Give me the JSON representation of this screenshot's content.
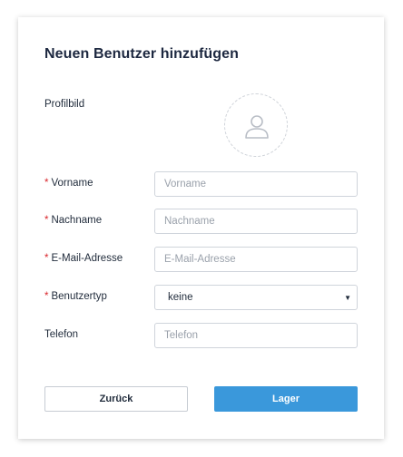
{
  "dialog": {
    "title": "Neuen Benutzer hinzufügen",
    "profile_label": "Profilbild",
    "avatar_icon": "user-icon",
    "required_marker": "*",
    "fields": {
      "first_name": {
        "label": "Vorname",
        "placeholder": "Vorname",
        "value": ""
      },
      "last_name": {
        "label": "Nachname",
        "placeholder": "Nachname",
        "value": ""
      },
      "email": {
        "label": "E-Mail-Adresse",
        "placeholder": "E-Mail-Adresse",
        "value": ""
      },
      "user_type": {
        "label": "Benutzertyp",
        "selected": "keine",
        "caret": "▼"
      },
      "phone": {
        "label": "Telefon",
        "placeholder": "Telefon",
        "value": ""
      }
    },
    "buttons": {
      "back_label": "Zurück",
      "save_label": "Lager"
    },
    "colors": {
      "required": "#d9262c",
      "primary": "#3a98db"
    }
  }
}
